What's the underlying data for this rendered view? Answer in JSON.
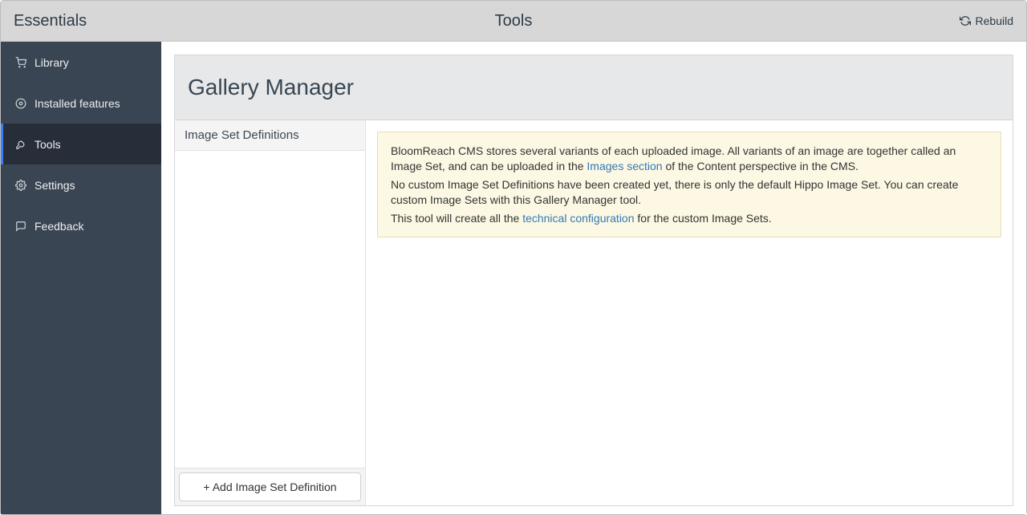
{
  "header": {
    "app_name": "Essentials",
    "section_title": "Tools",
    "rebuild_label": "Rebuild"
  },
  "sidebar": {
    "items": [
      {
        "label": "Library",
        "icon": "cart-icon"
      },
      {
        "label": "Installed features",
        "icon": "disc-icon"
      },
      {
        "label": "Tools",
        "icon": "wrench-icon"
      },
      {
        "label": "Settings",
        "icon": "gear-icon"
      },
      {
        "label": "Feedback",
        "icon": "chat-icon"
      }
    ],
    "active_index": 2
  },
  "main": {
    "panel_title": "Gallery Manager",
    "definitions_header": "Image Set Definitions",
    "add_button_label": "+ Add Image Set Definition",
    "notice": {
      "p1a": "BloomReach CMS stores several variants of each uploaded image. All variants of an image are together called an Image Set, and can be uploaded in the ",
      "p1_link": "Images section",
      "p1b": " of the Content perspective in the CMS.",
      "p2": "No custom Image Set Definitions have been created yet, there is only the default Hippo Image Set. You can create custom Image Sets with this Gallery Manager tool.",
      "p3a": "This tool will create all the ",
      "p3_link": "technical configuration",
      "p3b": " for the custom Image Sets."
    }
  }
}
